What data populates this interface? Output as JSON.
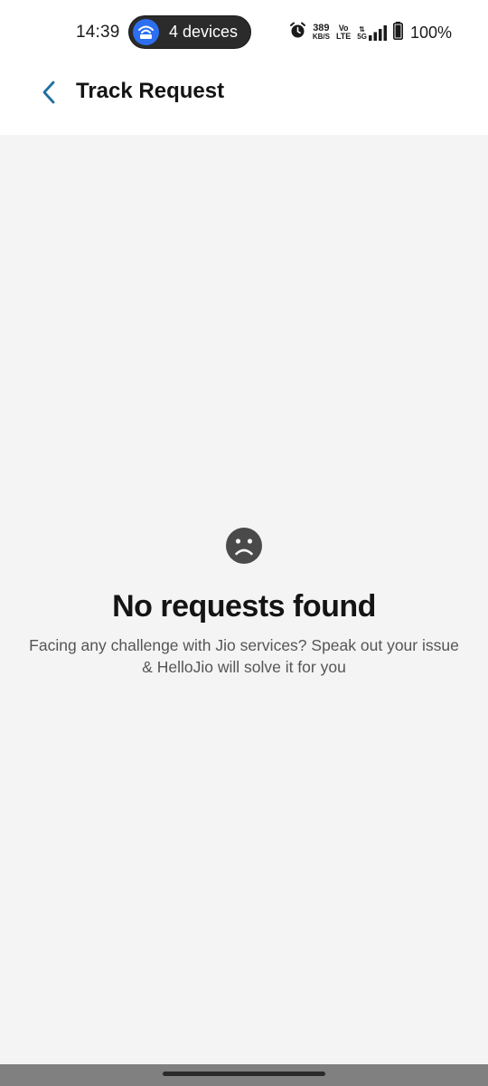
{
  "status_bar": {
    "time": "14:39",
    "hotspot_label": "4 devices",
    "speed_value": "389",
    "speed_unit": "KB/S",
    "volte_top": "Vo",
    "volte_bottom": "LTE",
    "network": "5G",
    "battery": "100%",
    "icons": [
      "alarm-icon",
      "signal-icon",
      "battery-icon",
      "wifi-hotspot-icon"
    ]
  },
  "app_bar": {
    "title": "Track Request",
    "back_icon": "chevron-left-icon",
    "accent_color": "#1f6fa0"
  },
  "empty_state": {
    "icon": "sad-face-icon",
    "title": "No requests found",
    "description": "Facing any challenge with Jio services? Speak out your issue & HelloJio will solve it for you"
  }
}
